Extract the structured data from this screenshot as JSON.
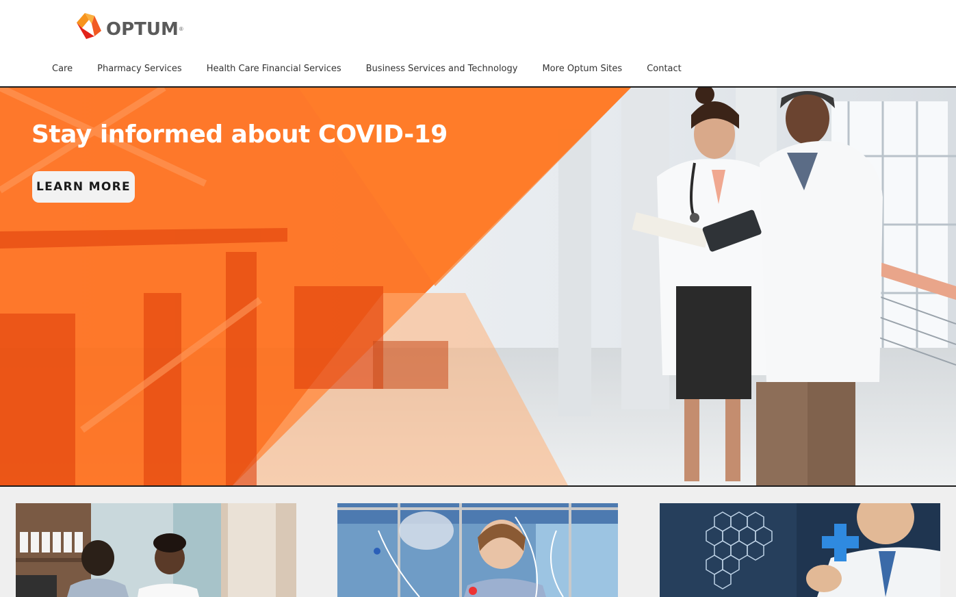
{
  "brand": {
    "name": "OPTUM",
    "registered_mark": "®",
    "logo_colors": [
      "#f7941d",
      "#f15a22",
      "#fbb040",
      "#e2231a"
    ]
  },
  "nav": {
    "items": [
      {
        "label": "Care"
      },
      {
        "label": "Pharmacy Services"
      },
      {
        "label": "Health Care Financial Services"
      },
      {
        "label": "Business Services and Technology"
      },
      {
        "label": "More Optum Sites"
      },
      {
        "label": "Contact"
      }
    ]
  },
  "hero": {
    "title": "Stay informed about COVID-19",
    "button_label": "LEARN MORE",
    "overlay_color": "#ff6a14",
    "image_icon": "doctors-reviewing-tablet-photo"
  },
  "cards": [
    {
      "image_icon": "pharmacy-consultation-photo"
    },
    {
      "image_icon": "laboratory-researcher-photo"
    },
    {
      "image_icon": "digital-health-technology-photo"
    }
  ]
}
